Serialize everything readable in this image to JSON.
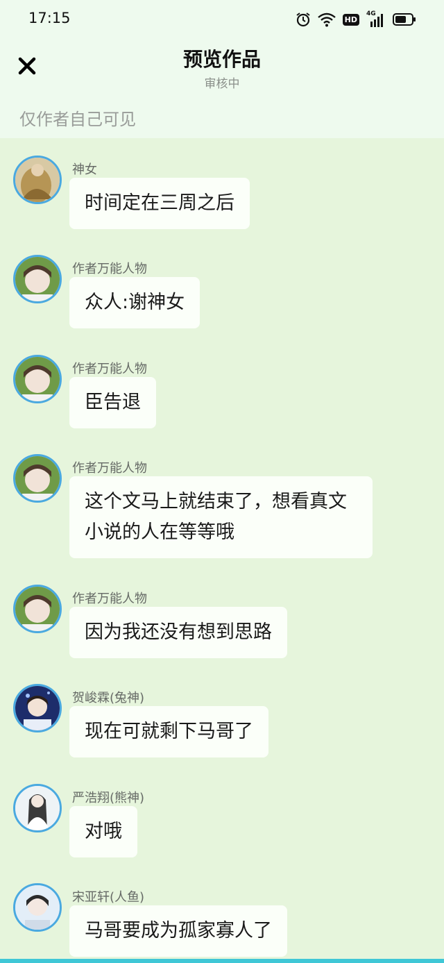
{
  "status": {
    "time": "17:15",
    "network": "4G",
    "hd": "HD"
  },
  "header": {
    "title": "预览作品",
    "subtitle": "审核中",
    "notice": "仅作者自己可见"
  },
  "messages": [
    {
      "name": "神女",
      "text": "时间定在三周之后",
      "avatar": "goddess-avatar"
    },
    {
      "name": "作者万能人物",
      "text": "众人:谢神女",
      "avatar": "author-avatar"
    },
    {
      "name": "作者万能人物",
      "text": "臣告退",
      "avatar": "author-avatar"
    },
    {
      "name": "作者万能人物",
      "text": "这个文马上就结束了，想看真文小说的人在等等哦",
      "avatar": "author-avatar"
    },
    {
      "name": "作者万能人物",
      "text": "因为我还没有想到思路",
      "avatar": "author-avatar"
    },
    {
      "name": "贺峻霖(兔神)",
      "text": "现在可就剩下马哥了",
      "avatar": "singer-avatar"
    },
    {
      "name": "严浩翔(熊神)",
      "text": "对哦",
      "avatar": "white-robe-avatar"
    },
    {
      "name": "宋亚轩(人鱼)",
      "text": "马哥要成为孤家寡人了",
      "avatar": "portrait-avatar"
    }
  ]
}
